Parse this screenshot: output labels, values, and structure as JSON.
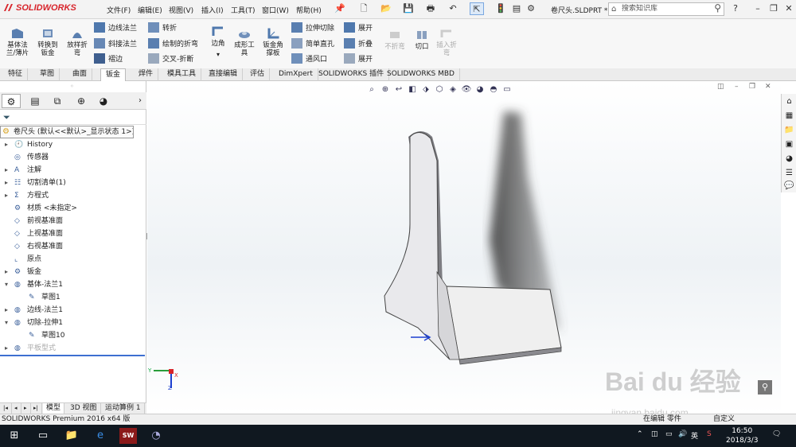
{
  "app": {
    "logo_text": "SOLIDWORKS",
    "brand_color": "#d8242b"
  },
  "menu": [
    "文件(F)",
    "编辑(E)",
    "视图(V)",
    "插入(I)",
    "工具(T)",
    "窗口(W)",
    "帮助(H)"
  ],
  "document_name": "卷尺头.SLDPRT *",
  "search_placeholder": "搜索知识库",
  "ribbon": {
    "large_buttons": [
      {
        "label": "基体法\n兰/薄片"
      },
      {
        "label": "转换到\n钣金"
      },
      {
        "label": "放样折\n弯"
      }
    ],
    "col1": [
      "边线法兰",
      "斜接法兰",
      "褶边"
    ],
    "col2": [
      "转折",
      "绘制的折弯",
      "交叉-折断"
    ],
    "corner": "边角",
    "forming_tool": "成形工\n具",
    "gusset": "钣金角\n撑板",
    "col3": [
      "拉伸切除",
      "简单直孔",
      "通风口"
    ],
    "col4": [
      "展开",
      "折叠",
      "展开"
    ],
    "no_bend": "不折弯",
    "rip": "切口",
    "insert_bend": "插入折\n弯"
  },
  "tabs": [
    "特征",
    "草图",
    "曲面",
    "钣金",
    "焊件",
    "模具工具",
    "直接编辑",
    "评估",
    "DimXpert",
    "SOLIDWORKS 插件",
    "SOLIDWORKS MBD"
  ],
  "active_tab": "钣金",
  "tree": {
    "root": "卷尺头 (默认<<默认>_显示状态 1>)",
    "items": [
      {
        "label": "History",
        "exp": "▸",
        "indent": 0
      },
      {
        "label": "传感器",
        "exp": "",
        "indent": 0
      },
      {
        "label": "注解",
        "exp": "▸",
        "indent": 0
      },
      {
        "label": "切割清单(1)",
        "exp": "▸",
        "indent": 0
      },
      {
        "label": "方程式",
        "exp": "▸",
        "indent": 0
      },
      {
        "label": "材质 <未指定>",
        "exp": "",
        "indent": 0
      },
      {
        "label": "前视基准面",
        "exp": "",
        "indent": 0
      },
      {
        "label": "上视基准面",
        "exp": "",
        "indent": 0
      },
      {
        "label": "右视基准面",
        "exp": "",
        "indent": 0
      },
      {
        "label": "原点",
        "exp": "",
        "indent": 0
      },
      {
        "label": "钣金",
        "exp": "▸",
        "indent": 0
      },
      {
        "label": "基体-法兰1",
        "exp": "▾",
        "indent": 0
      },
      {
        "label": "草图1",
        "exp": "",
        "indent": 1
      },
      {
        "label": "边线-法兰1",
        "exp": "▸",
        "indent": 0
      },
      {
        "label": "切除-拉伸1",
        "exp": "▾",
        "indent": 0
      },
      {
        "label": "草图10",
        "exp": "",
        "indent": 1
      },
      {
        "label": "平板型式",
        "exp": "▸",
        "indent": 0,
        "faded": true
      }
    ]
  },
  "bottom_tabs": [
    "模型",
    "3D 视图",
    "运动算例 1"
  ],
  "status_text": "SOLIDWORKS Premium 2016 x64 版",
  "status_right": [
    "在编辑 零件",
    "自定义"
  ],
  "triad": {
    "x_label": "X",
    "y_label": "Y",
    "z_label": "Z"
  },
  "watermark": {
    "main": "Bai du 经验",
    "sub": "jingyan.baidu.com"
  },
  "taskbar": {
    "time": "16:50",
    "date": "2018/3/3",
    "ime": "英"
  }
}
